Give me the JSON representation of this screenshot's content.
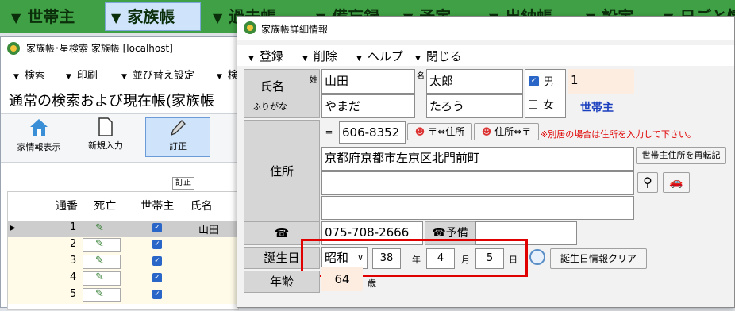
{
  "top_menu": {
    "items": [
      "世帯主",
      "家族帳",
      "過去帳",
      "備忘録",
      "予定",
      "出納帳",
      "設定",
      "日ごと情"
    ]
  },
  "bg_window": {
    "title": "家族帳･星検索 家族帳 [localhost]",
    "menu": [
      "検索",
      "印刷",
      "並び替え設定",
      "検"
    ],
    "heading": "通常の検索および現在帳(家族帳",
    "toolbar": [
      "家情報表示",
      "新規入力",
      "訂正"
    ],
    "tooltip": "訂正",
    "columns": [
      "通番",
      "死亡",
      "世帯主",
      "氏名"
    ],
    "rows": [
      {
        "no": "1",
        "name": "山田"
      },
      {
        "no": "2",
        "name": ""
      },
      {
        "no": "3",
        "name": ""
      },
      {
        "no": "4",
        "name": ""
      },
      {
        "no": "5",
        "name": ""
      }
    ]
  },
  "detail_window": {
    "title": "家族帳詳細情報",
    "menu": [
      "登録",
      "削除",
      "ヘルプ",
      "閉じる"
    ],
    "labels": {
      "name": "氏名",
      "furigana": "ふりがな",
      "sei": "姓",
      "mei": "名",
      "address": "住所",
      "birthday": "誕生日",
      "age": "年齢"
    },
    "surname": "山田",
    "given_name": "太郎",
    "surname_kana": "やまだ",
    "given_kana": "たろう",
    "gender_male": "男",
    "gender_female": "女",
    "household_no": "1",
    "household_head": "世帯主",
    "postal_mark": "〒",
    "postal_code": "606-8352",
    "btn_zip_to_addr": "〒⇔住所",
    "btn_addr_to_zip": "住所⇔〒",
    "separate_note": "※別居の場合は住所を入力して下さい。",
    "btn_reset_head_address": "世帯主住所を再転記",
    "address_line1": "京都府京都市左京区北門前町",
    "address_line2": "",
    "address_line3": "",
    "phone": "075-708-2666",
    "phone_spare_label": "☎予備",
    "phone_spare": "",
    "era": "昭和",
    "year": "38",
    "year_unit": "年",
    "month": "4",
    "month_unit": "月",
    "day": "5",
    "day_unit": "日",
    "btn_clear_birthday": "誕生日情報クリア",
    "age": "64",
    "age_unit": "歳"
  },
  "colors": {
    "menu_green": "#3fa045",
    "highlight_red": "#e00000",
    "head_blue": "#1a3fbf"
  }
}
